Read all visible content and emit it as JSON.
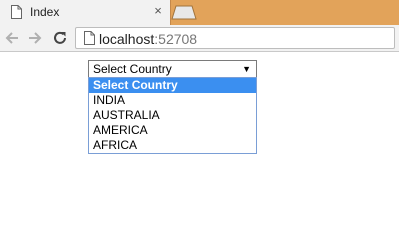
{
  "browser": {
    "tab_title": "Index",
    "tab_close_label": "×",
    "url_host": "localhost",
    "url_port": ":52708"
  },
  "form": {
    "select_value": "Select Country",
    "select_arrow": "▼",
    "options": [
      {
        "label": "Select Country",
        "selected": true
      },
      {
        "label": "INDIA"
      },
      {
        "label": "AUSTRALIA"
      },
      {
        "label": "AMERICA"
      },
      {
        "label": "AFRICA"
      }
    ]
  },
  "colors": {
    "tabstrip": "#e2a35a",
    "highlight": "#3b8ff0"
  }
}
